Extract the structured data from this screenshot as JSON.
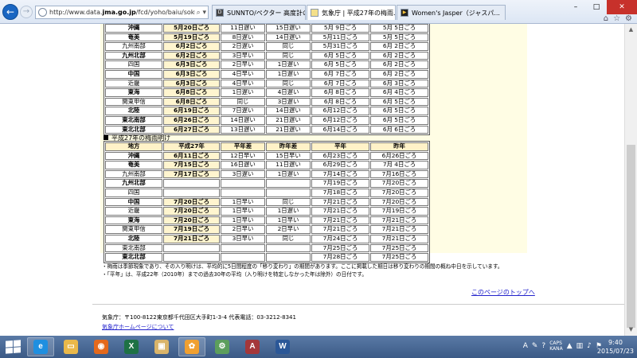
{
  "browser": {
    "url_prefix": "http://www.data.",
    "url_domain": "jma.go.jp",
    "url_path": "/fcd/yoho/baiu/sokuho",
    "search_glyph": "⌕ ▾",
    "tabs": [
      {
        "label": "SUNNTO/ペクター 高度計の...",
        "favicon": "D"
      },
      {
        "label": "気象庁 | 平成27年の梅雨...",
        "favicon": ""
      },
      {
        "label": "Women's Jasper（ジャスパ...",
        "favicon": "▶"
      }
    ],
    "close_glyph": "×",
    "window_controls": {
      "minimize": "–",
      "maximize": "□",
      "close": "✕"
    },
    "tool_icons": {
      "home": "⌂",
      "favorites": "☆",
      "settings": "⚙"
    }
  },
  "table1": {
    "rows": [
      [
        "沖縄",
        "5月20日ごろ",
        "11日遅い",
        "15日遅い",
        "5月 9日ごろ",
        "5月 5日ごろ"
      ],
      [
        "奄美",
        "5月19日ごろ",
        "8日遅い",
        "14日遅い",
        "5月11日ごろ",
        "5月 5日ごろ"
      ],
      [
        "九州南部",
        "6月2日ごろ",
        "2日遅い",
        "同じ",
        "5月31日ごろ",
        "6月 2日ごろ"
      ],
      [
        "九州北部",
        "6月2日ごろ",
        "3日早い",
        "同じ",
        "6月 5日ごろ",
        "6月 2日ごろ"
      ],
      [
        "四国",
        "6月3日ごろ",
        "2日早い",
        "1日遅い",
        "6月 5日ごろ",
        "6月 2日ごろ"
      ],
      [
        "中国",
        "6月3日ごろ",
        "4日早い",
        "1日遅い",
        "6月 7日ごろ",
        "6月 2日ごろ"
      ],
      [
        "近畿",
        "6月3日ごろ",
        "4日早い",
        "同じ",
        "6月 7日ごろ",
        "6月 3日ごろ"
      ],
      [
        "東海",
        "6月8日ごろ",
        "1日遅い",
        "4日遅い",
        "6月 8日ごろ",
        "6月 4日ごろ"
      ],
      [
        "関東甲信",
        "6月8日ごろ",
        "同じ",
        "3日遅い",
        "6月 8日ごろ",
        "6月 5日ごろ"
      ],
      [
        "北陸",
        "6月19日ごろ",
        "7日遅い",
        "14日遅い",
        "6月12日ごろ",
        "6月 5日ごろ"
      ],
      [
        "東北南部",
        "6月26日ごろ",
        "14日遅い",
        "21日遅い",
        "6月12日ごろ",
        "6月 5日ごろ"
      ],
      [
        "東北北部",
        "6月27日ごろ",
        "13日遅い",
        "21日遅い",
        "6月14日ごろ",
        "6月 6日ごろ"
      ]
    ]
  },
  "table2": {
    "heading": "平成27年の梅雨明け",
    "headers": [
      "地方",
      "平成27年",
      "平年差",
      "昨年差",
      "平年",
      "昨年"
    ],
    "rows": [
      [
        "沖縄",
        "6月11日ごろ",
        "12日早い",
        "15日早い",
        "6月23日ごろ",
        "6月26日ごろ"
      ],
      [
        "奄美",
        "7月15日ごろ",
        "16日遅い",
        "11日遅い",
        "6月29日ごろ",
        "7月 4日ごろ"
      ],
      [
        "九州南部",
        "7月17日ごろ",
        "3日遅い",
        "1日遅い",
        "7月14日ごろ",
        "7月16日ごろ"
      ],
      [
        "九州北部",
        "",
        "",
        "",
        "7月19日ごろ",
        "7月20日ごろ"
      ],
      [
        "四国",
        "",
        "",
        "",
        "7月18日ごろ",
        "7月20日ごろ"
      ],
      [
        "中国",
        "7月20日ごろ",
        "1日早い",
        "同じ",
        "7月21日ごろ",
        "7月20日ごろ"
      ],
      [
        "近畿",
        "7月20日ごろ",
        "1日早い",
        "1日遅い",
        "7月21日ごろ",
        "7月19日ごろ"
      ],
      [
        "東海",
        "7月20日ごろ",
        "1日早い",
        "1日早い",
        "7月21日ごろ",
        "7月21日ごろ"
      ],
      [
        "関東甲信",
        "7月19日ごろ",
        "2日早い",
        "2日早い",
        "7月21日ごろ",
        "7月21日ごろ"
      ],
      [
        "北陸",
        "7月21日ごろ",
        "3日早い",
        "同じ",
        "7月24日ごろ",
        "7月21日ごろ"
      ],
      [
        "東北南部",
        "",
        "",
        "",
        "7月25日ごろ",
        "7月25日ごろ"
      ],
      [
        "東北北部",
        "",
        "",
        "",
        "7月28日ごろ",
        "7月25日ごろ"
      ]
    ]
  },
  "notes": {
    "line1": "・梅雨は季節現象であり、その入り明けは、平均的に5日間程度の「移り変わり」の期間があります。ここに掲載した期日は移り変わりの期間の概ね中日を示しています。",
    "line2": "・「平年」は、平成22年（2010年）までの過去30年の平均（入り明けを特定しなかった年は除外）の日付です。"
  },
  "footer": {
    "to_top": "このページのトップへ",
    "address": "気象庁：〒100-8122東京都千代田区大手町1-3-4 代表電話：03-3212-8341",
    "home_link": "気象庁ホームページについて"
  },
  "taskbar": {
    "apps": [
      {
        "id": "ie",
        "glyph": "e",
        "color": "#1f8fe0"
      },
      {
        "id": "explorer",
        "glyph": "▭",
        "color": "#e9b84a"
      },
      {
        "id": "firefox",
        "glyph": "◉",
        "color": "#e4691c"
      },
      {
        "id": "excel",
        "glyph": "X",
        "color": "#1e7145"
      },
      {
        "id": "viewer",
        "glyph": "▣",
        "color": "#d9b46a"
      },
      {
        "id": "paint",
        "glyph": "✿",
        "color": "#f0a030"
      },
      {
        "id": "tools",
        "glyph": "⚙",
        "color": "#5c9e5c"
      },
      {
        "id": "access",
        "glyph": "A",
        "color": "#a4373a"
      },
      {
        "id": "word",
        "glyph": "W",
        "color": "#2b5797"
      }
    ],
    "tray": {
      "ime_mode": "A",
      "ime_top": "CAPS",
      "ime_bottom": "KANA"
    },
    "clock": {
      "time": "9:40",
      "date": "2015/07/23"
    }
  },
  "colors": {
    "table_header_bg": "#fff2c8",
    "content_bg": "#fffde4",
    "link": "#2222cc",
    "taskbar": "#3b5a86"
  }
}
